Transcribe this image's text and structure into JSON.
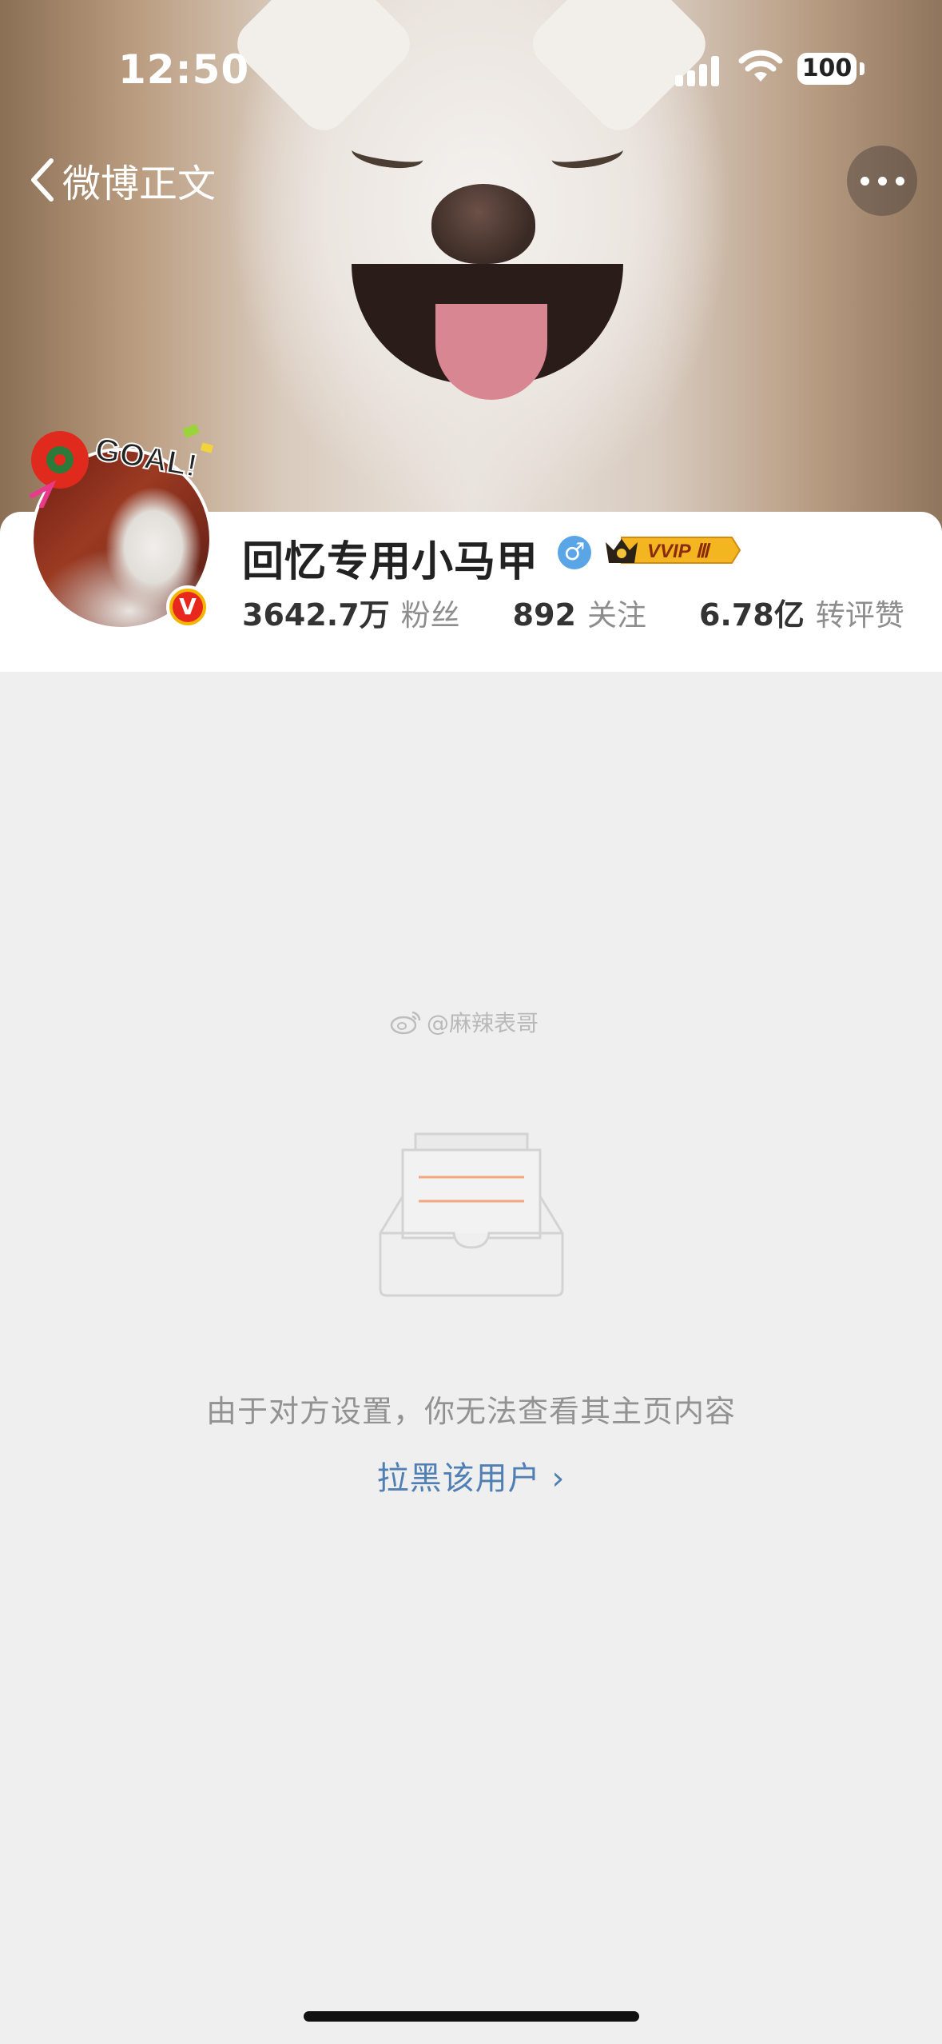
{
  "status_bar": {
    "time": "12:50",
    "battery": "100"
  },
  "nav": {
    "back_label": "微博正文"
  },
  "profile": {
    "name": "回忆专用小马甲",
    "gender_symbol": "♂",
    "vip_label": "VVIP Ⅲ",
    "avatar_sticker_text": "GOAL!",
    "verified_mark": "V",
    "stats": [
      {
        "value": "3642.7万",
        "label": "粉丝"
      },
      {
        "value": "892",
        "label": "关注"
      },
      {
        "value": "6.78亿",
        "label": "转评赞"
      }
    ]
  },
  "watermark": "@麻辣表哥",
  "empty": {
    "message": "由于对方设置，你无法查看其主页内容",
    "block_link": "拉黑该用户 ›"
  },
  "colors": {
    "link": "#4f7fb3",
    "vip_gold": "#f5b400",
    "verified_red": "#e8281d",
    "background": "#efefef"
  }
}
